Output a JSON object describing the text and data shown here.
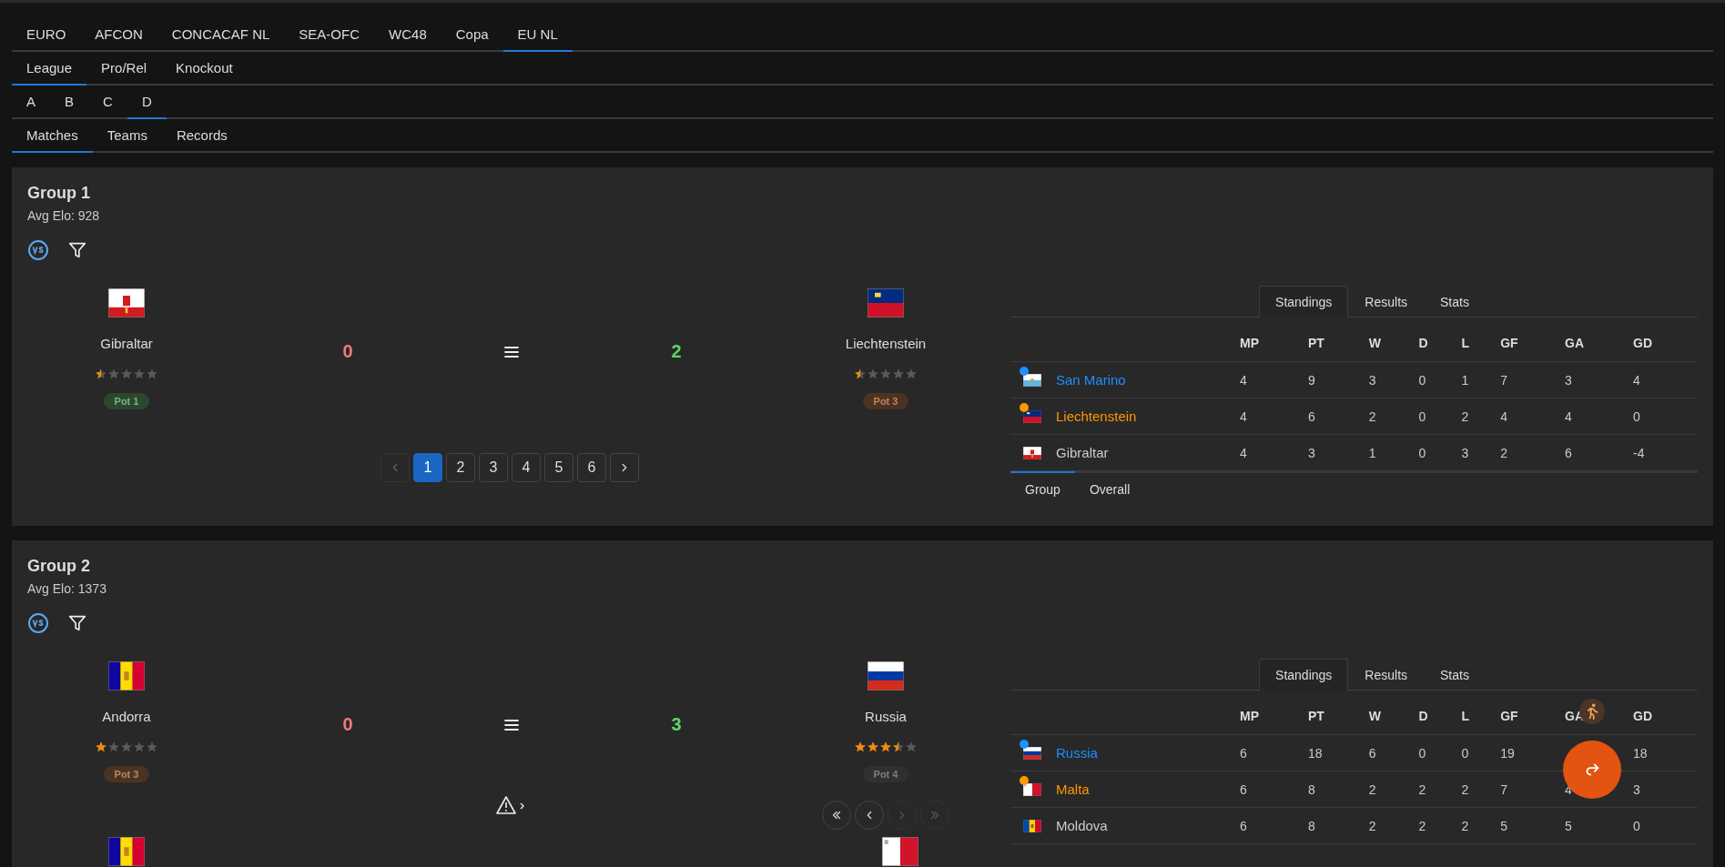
{
  "nav_rows": [
    {
      "tabs": [
        {
          "label": "EURO",
          "selected": false
        },
        {
          "label": "AFCON",
          "selected": false
        },
        {
          "label": "CONCACAF NL",
          "selected": false
        },
        {
          "label": "SEA-OFC",
          "selected": false
        },
        {
          "label": "WC48",
          "selected": false
        },
        {
          "label": "Copa",
          "selected": false
        },
        {
          "label": "EU NL",
          "selected": true
        }
      ]
    },
    {
      "tabs": [
        {
          "label": "League",
          "selected": true
        },
        {
          "label": "Pro/Rel",
          "selected": false
        },
        {
          "label": "Knockout",
          "selected": false
        }
      ]
    },
    {
      "tabs": [
        {
          "label": "A",
          "selected": false
        },
        {
          "label": "B",
          "selected": false
        },
        {
          "label": "C",
          "selected": false
        },
        {
          "label": "D",
          "selected": true
        }
      ]
    },
    {
      "tabs": [
        {
          "label": "Matches",
          "selected": true
        },
        {
          "label": "Teams",
          "selected": false
        },
        {
          "label": "Records",
          "selected": false
        }
      ]
    }
  ],
  "groups": [
    {
      "title": "Group 1",
      "avg_elo": "Avg Elo: 928",
      "match": {
        "home": {
          "name": "Gibraltar",
          "flag": {
            "kind": "gibraltar"
          },
          "stars": 0.5,
          "pot": {
            "label": "Pot 1",
            "color": "#2d4630"
          },
          "score": "0",
          "won": false
        },
        "away": {
          "name": "Liechtenstein",
          "flag": {
            "kind": "liechtenstein"
          },
          "stars": 0.5,
          "pot": {
            "label": "Pot 3",
            "color": "#4a3323"
          },
          "score": "2",
          "won": true
        }
      },
      "pager": {
        "kind": "pages",
        "prev_disabled": true,
        "next_disabled": false,
        "pages": [
          {
            "label": "1",
            "selected": true
          },
          {
            "label": "2",
            "selected": false
          },
          {
            "label": "3",
            "selected": false
          },
          {
            "label": "4",
            "selected": false
          },
          {
            "label": "5",
            "selected": false
          },
          {
            "label": "6",
            "selected": false
          }
        ]
      },
      "standings": {
        "tabs": [
          {
            "label": "Standings",
            "selected": true
          },
          {
            "label": "Results",
            "selected": false
          },
          {
            "label": "Stats",
            "selected": false
          }
        ],
        "columns": [
          "MP",
          "PT",
          "W",
          "D",
          "L",
          "GF",
          "GA",
          "GD"
        ],
        "rows": [
          {
            "name": "San Marino",
            "flag": {
              "kind": "san_marino"
            },
            "color": "#1e90ff",
            "cells": [
              {
                "text": "4"
              },
              {
                "text": "9"
              },
              {
                "text": "3"
              },
              {
                "text": "0"
              },
              {
                "text": "1"
              },
              {
                "text": "7"
              },
              {
                "text": "3"
              },
              {
                "text": "4"
              }
            ]
          },
          {
            "name": "Liechtenstein",
            "flag": {
              "kind": "liechtenstein"
            },
            "color": "#ff9800",
            "cells": [
              {
                "text": "4"
              },
              {
                "text": "6"
              },
              {
                "text": "2"
              },
              {
                "text": "0"
              },
              {
                "text": "2"
              },
              {
                "text": "4"
              },
              {
                "text": "4"
              },
              {
                "text": "0"
              }
            ]
          },
          {
            "name": "Gibraltar",
            "flag": {
              "kind": "gibraltar"
            },
            "cells": [
              {
                "text": "4"
              },
              {
                "text": "3"
              },
              {
                "text": "1"
              },
              {
                "text": "0"
              },
              {
                "text": "3"
              },
              {
                "text": "2"
              },
              {
                "text": "6"
              },
              {
                "text": "-4"
              }
            ]
          }
        ],
        "subtabs": [
          {
            "label": "Group",
            "selected": true
          },
          {
            "label": "Overall",
            "selected": false
          }
        ]
      }
    },
    {
      "title": "Group 2",
      "avg_elo": "Avg Elo: 1373",
      "match": {
        "home": {
          "name": "Andorra",
          "flag": {
            "kind": "andorra"
          },
          "stars": 1,
          "pot": {
            "label": "Pot 3",
            "color": "#4a3323"
          },
          "score": "0",
          "won": false
        },
        "away": {
          "name": "Russia",
          "flag": {
            "kind": "russia"
          },
          "stars": 3.5,
          "pot": {
            "label": "Pot 4",
            "color": "#303030"
          },
          "score": "3",
          "won": true
        }
      },
      "pager": {
        "kind": "nav",
        "warning": true,
        "buttons": [
          {
            "kind": "first",
            "disabled": false
          },
          {
            "kind": "prev",
            "disabled": false
          },
          {
            "kind": "next",
            "disabled": true
          },
          {
            "kind": "last",
            "disabled": true
          }
        ]
      },
      "next_match": {
        "home_flag": {
          "kind": "andorra"
        },
        "away_flag": {
          "kind": "malta"
        }
      },
      "standings": {
        "tabs": [
          {
            "label": "Standings",
            "selected": true
          },
          {
            "label": "Results",
            "selected": false
          },
          {
            "label": "Stats",
            "selected": false
          }
        ],
        "columns": [
          "MP",
          "PT",
          "W",
          "D",
          "L",
          "GF",
          "GA",
          "GD"
        ],
        "rows": [
          {
            "name": "Russia",
            "flag": {
              "kind": "russia"
            },
            "color": "#1e90ff",
            "cells": [
              {
                "text": "6"
              },
              {
                "text": "18"
              },
              {
                "text": "6"
              },
              {
                "text": "0"
              },
              {
                "text": "0"
              },
              {
                "text": "19"
              },
              {
                "kind": "covered"
              },
              {
                "text": "18"
              }
            ]
          },
          {
            "name": "Malta",
            "flag": {
              "kind": "malta"
            },
            "color": "#ff9800",
            "cells": [
              {
                "text": "6"
              },
              {
                "text": "8"
              },
              {
                "text": "2"
              },
              {
                "text": "2"
              },
              {
                "text": "2"
              },
              {
                "text": "7"
              },
              {
                "text": "4"
              },
              {
                "text": "3"
              }
            ]
          },
          {
            "name": "Moldova",
            "flag": {
              "kind": "moldova"
            },
            "cells": [
              {
                "text": "6"
              },
              {
                "text": "8"
              },
              {
                "text": "2"
              },
              {
                "text": "2"
              },
              {
                "text": "2"
              },
              {
                "text": "5"
              },
              {
                "text": "5"
              },
              {
                "text": "0"
              }
            ]
          }
        ]
      }
    }
  ]
}
